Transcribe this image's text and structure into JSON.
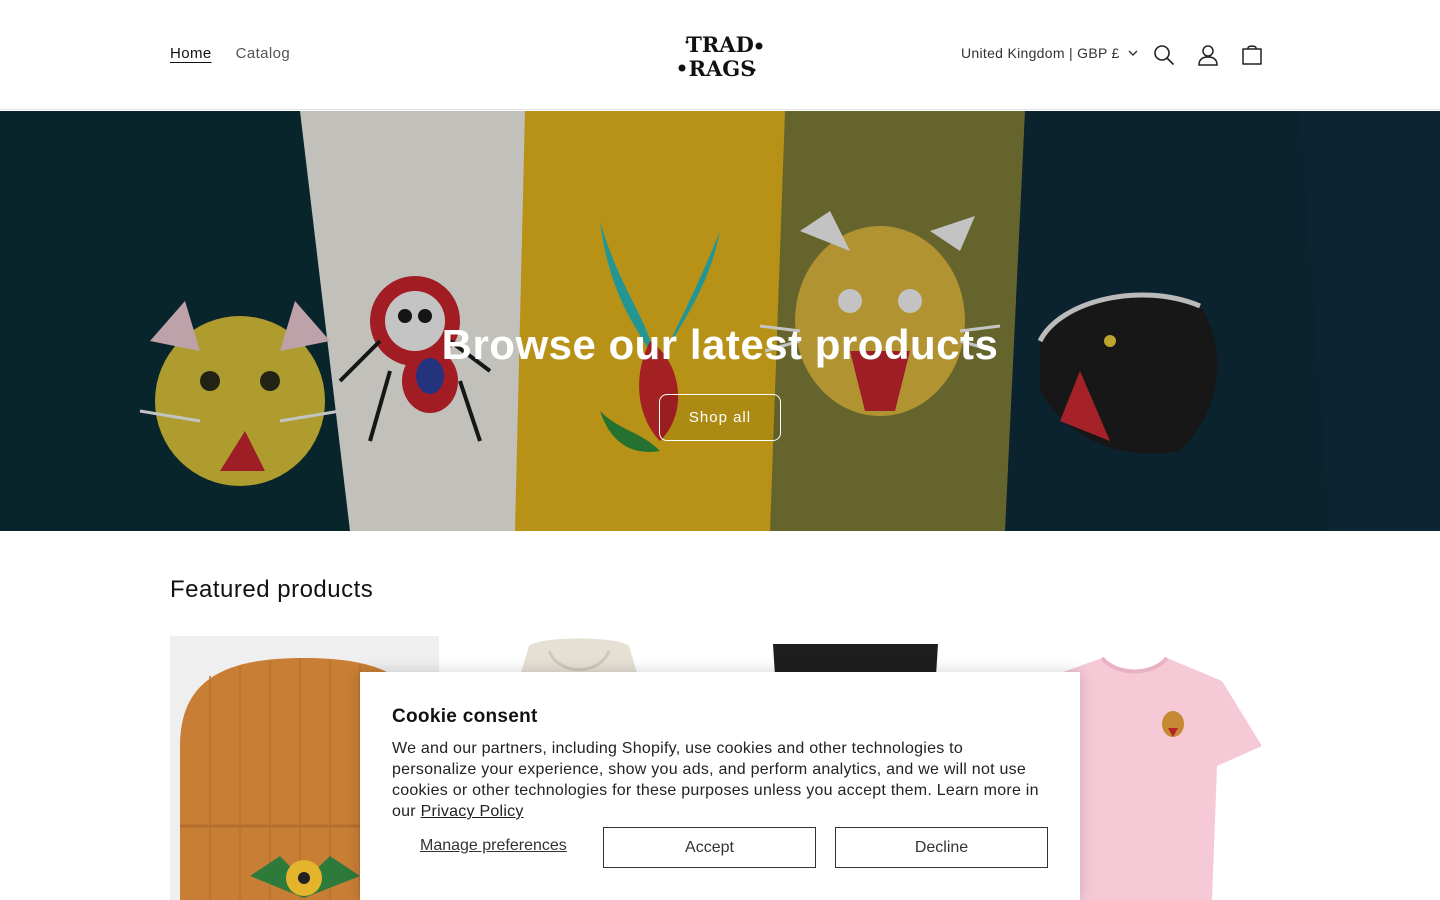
{
  "header": {
    "nav": [
      {
        "label": "Home",
        "active": true
      },
      {
        "label": "Catalog",
        "active": false
      }
    ],
    "logo_text": [
      "TRAD",
      "RAGS"
    ],
    "country_selector": "United Kingdom | GBP £",
    "icons": [
      "search-icon",
      "account-icon",
      "cart-icon"
    ]
  },
  "hero": {
    "title": "Browse our latest products",
    "button_label": "Shop all",
    "shirt_colors": [
      "#0c2e36",
      "#ecebe4",
      "#e0b21c",
      "#7d7a37",
      "#0e2a3a"
    ]
  },
  "featured": {
    "title": "Featured products",
    "products": [
      {
        "name": "orange-beanie",
        "color": "#c97e35"
      },
      {
        "name": "cream-hoodie",
        "color": "#e6e0d4"
      },
      {
        "name": "black-sweatpants",
        "color": "#1e1e1e"
      },
      {
        "name": "pink-tshirt",
        "color": "#f6c9d6"
      }
    ]
  },
  "cookie": {
    "title": "Cookie consent",
    "body": "We and our partners, including Shopify, use cookies and other technologies to personalize your experience, show you ads, and perform analytics, and we will not use cookies or other technologies for these purposes unless you accept them. Learn more in our ",
    "privacy_link": "Privacy Policy",
    "manage": "Manage preferences",
    "accept": "Accept",
    "decline": "Decline"
  }
}
